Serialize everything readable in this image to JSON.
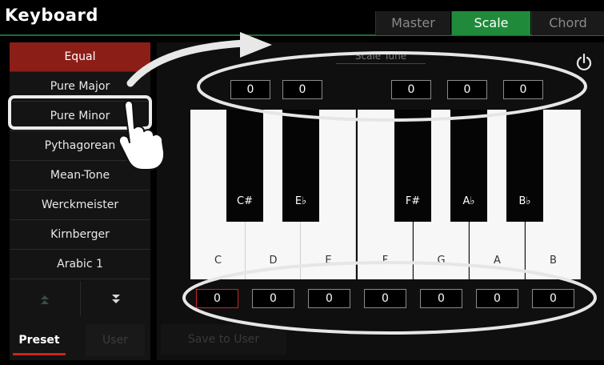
{
  "header": {
    "title": "Keyboard",
    "tabs": [
      {
        "label": "Master",
        "active": false
      },
      {
        "label": "Scale",
        "active": true
      },
      {
        "label": "Chord",
        "active": false
      }
    ]
  },
  "sidebar": {
    "presets": [
      {
        "label": "Equal",
        "selected": true
      },
      {
        "label": "Pure Major",
        "selected": false
      },
      {
        "label": "Pure Minor",
        "selected": false
      },
      {
        "label": "Pythagorean",
        "selected": false
      },
      {
        "label": "Mean-Tone",
        "selected": false
      },
      {
        "label": "Werckmeister",
        "selected": false
      },
      {
        "label": "Kirnberger",
        "selected": false
      },
      {
        "label": "Arabic 1",
        "selected": false
      }
    ],
    "scroll_up_icon": "double-chevron-up-icon",
    "scroll_down_icon": "double-chevron-down-icon",
    "bottom_tabs": {
      "preset": "Preset",
      "user": "User"
    }
  },
  "main": {
    "panel_title": "Scale Tune",
    "power_icon": "power-icon",
    "save_button": "Save to User",
    "black_keys": [
      {
        "label": "C#",
        "value": "0"
      },
      {
        "label": "E♭",
        "value": "0"
      },
      {
        "label": "F#",
        "value": "0"
      },
      {
        "label": "A♭",
        "value": "0"
      },
      {
        "label": "B♭",
        "value": "0"
      }
    ],
    "white_keys": [
      {
        "label": "C",
        "value": "0"
      },
      {
        "label": "D",
        "value": "0"
      },
      {
        "label": "E",
        "value": "0"
      },
      {
        "label": "F",
        "value": "0"
      },
      {
        "label": "G",
        "value": "0"
      },
      {
        "label": "A",
        "value": "0"
      },
      {
        "label": "B",
        "value": "0"
      }
    ]
  },
  "colors": {
    "accent_green": "#1f8a3a",
    "selected_red": "#8c1e18",
    "highlight_outline": "#e6e6e6"
  },
  "annotation": {
    "hand_icon": "pointing-hand-icon",
    "arrow_icon": "curved-arrow-icon"
  }
}
